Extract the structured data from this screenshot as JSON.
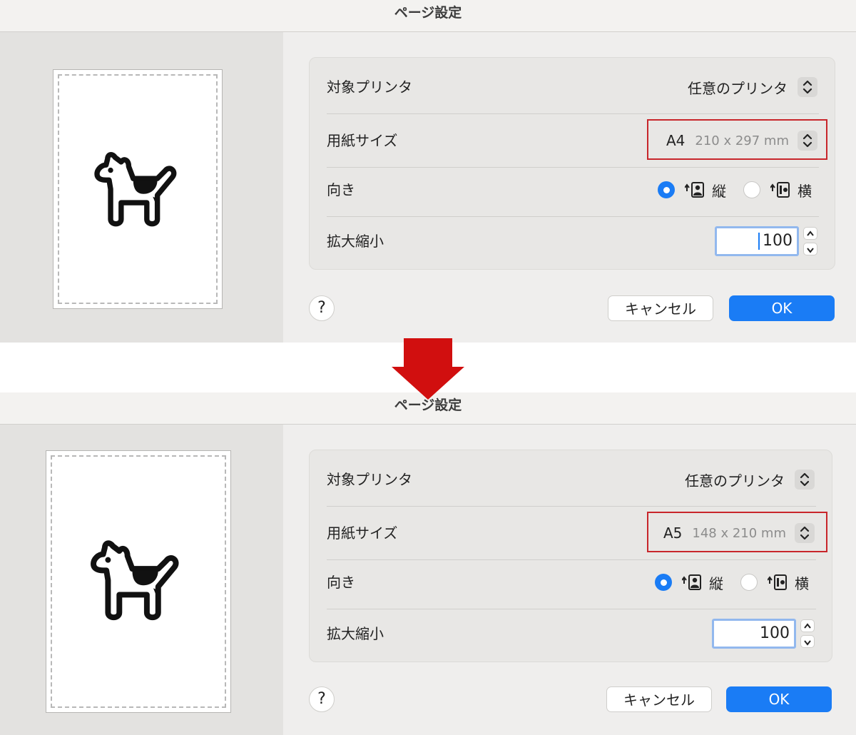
{
  "colors": {
    "accent": "#1a7cf5",
    "highlight": "#c8262b",
    "arrow": "#d10f0f"
  },
  "icons": [
    "dog-icon",
    "chevron-updown-icon",
    "portrait-orientation-icon",
    "landscape-orientation-icon",
    "down-arrow-icon",
    "help-icon"
  ],
  "before": {
    "title": "ページ設定",
    "printer_label": "対象プリンタ",
    "printer_value": "任意のプリンタ",
    "paper_label": "用紙サイズ",
    "paper_value": "A4",
    "paper_dims": "210 x 297 mm",
    "orientation_label": "向き",
    "portrait_label": "縦",
    "landscape_label": "横",
    "scale_label": "拡大縮小",
    "scale_value": "100",
    "help": "?",
    "cancel": "キャンセル",
    "ok": "OK"
  },
  "after": {
    "title": "ページ設定",
    "printer_label": "対象プリンタ",
    "printer_value": "任意のプリンタ",
    "paper_label": "用紙サイズ",
    "paper_value": "A5",
    "paper_dims": "148 x 210 mm",
    "orientation_label": "向き",
    "portrait_label": "縦",
    "landscape_label": "横",
    "scale_label": "拡大縮小",
    "scale_value": "100",
    "help": "?",
    "cancel": "キャンセル",
    "ok": "OK"
  }
}
